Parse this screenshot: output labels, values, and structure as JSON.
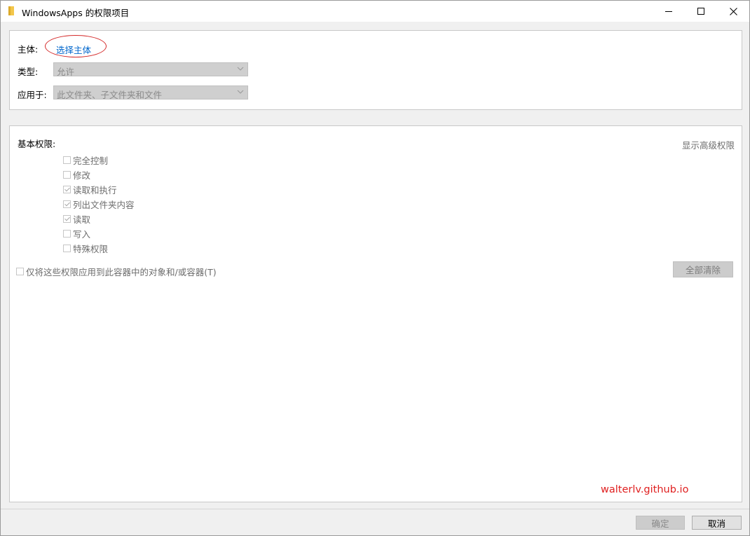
{
  "window": {
    "title": "WindowsApps 的权限项目",
    "icon": "folder-icon",
    "controls": [
      "minimize-icon",
      "maximize-icon",
      "close-icon"
    ]
  },
  "principal": {
    "label": "主体:",
    "link": "选择主体"
  },
  "type": {
    "label": "类型:",
    "value": "允许"
  },
  "applies_to": {
    "label": "应用于:",
    "value": "此文件夹、子文件夹和文件"
  },
  "permissions": {
    "heading": "基本权限:",
    "advanced_link": "显示高级权限",
    "items": [
      {
        "label": "完全控制",
        "checked": false
      },
      {
        "label": "修改",
        "checked": false
      },
      {
        "label": "读取和执行",
        "checked": true
      },
      {
        "label": "列出文件夹内容",
        "checked": true
      },
      {
        "label": "读取",
        "checked": true
      },
      {
        "label": "写入",
        "checked": false
      },
      {
        "label": "特殊权限",
        "checked": false
      }
    ],
    "apply_only_label": "仅将这些权限应用到此容器中的对象和/或容器(T)",
    "clear_all": "全部清除"
  },
  "watermark": "walterlv.github.io",
  "footer": {
    "ok": "确定",
    "cancel": "取消"
  },
  "colors": {
    "link": "#0066cc",
    "annotation": "#d42a2a",
    "watermark": "#e02020",
    "disabled_text": "#6d6d6d"
  }
}
